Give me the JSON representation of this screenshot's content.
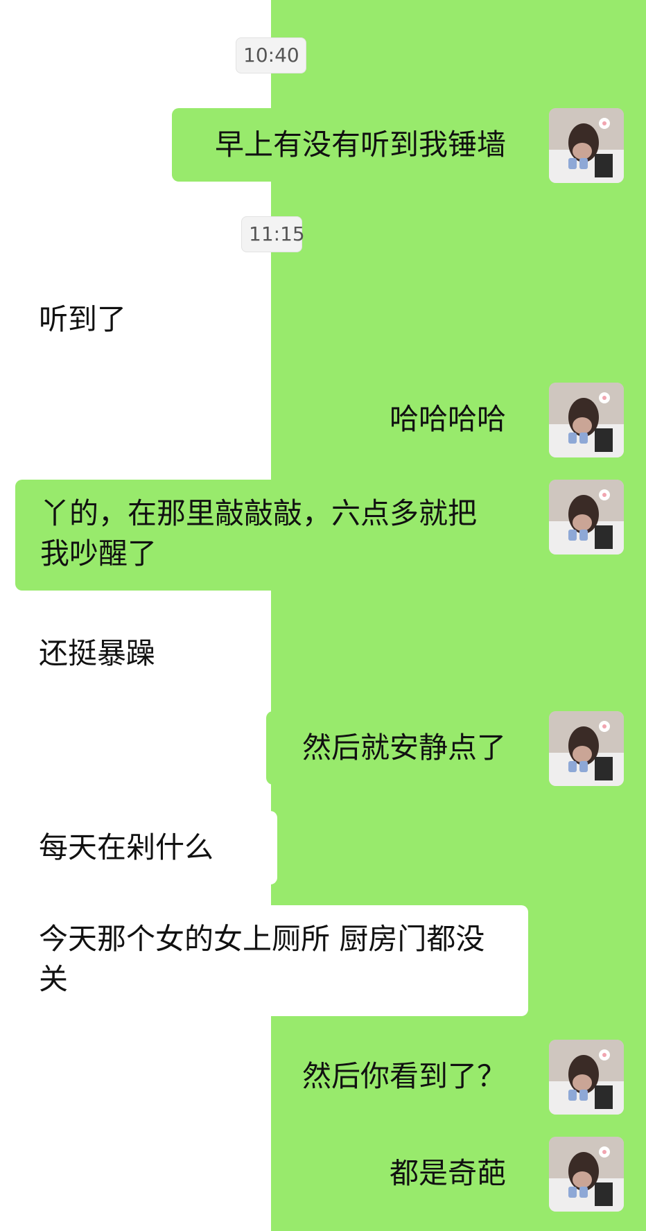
{
  "theme": {
    "right_background": "#98ea6c",
    "left_background": "#ffffff",
    "outgoing_bubble": "#98ea6c",
    "incoming_bubble": "#ffffff"
  },
  "timestamps": [
    {
      "label": "10:40"
    },
    {
      "label": "11:15"
    }
  ],
  "messages": [
    {
      "side": "right",
      "text": "早上有没有听到我锤墙",
      "avatar_icon": "user-avatar-icon"
    },
    {
      "side": "left",
      "text": "听到了"
    },
    {
      "side": "right",
      "text": "哈哈哈哈",
      "avatar_icon": "user-avatar-icon"
    },
    {
      "side": "right",
      "text": "丫的，在那里敲敲敲，六点多就把我吵醒了",
      "avatar_icon": "user-avatar-icon"
    },
    {
      "side": "left",
      "text": "还挺暴躁"
    },
    {
      "side": "right",
      "text": "然后就安静点了",
      "avatar_icon": "user-avatar-icon"
    },
    {
      "side": "left",
      "text": "每天在剁什么"
    },
    {
      "side": "left",
      "text": "今天那个女的女上厕所 厨房门都没关"
    },
    {
      "side": "right",
      "text": "然后你看到了？",
      "avatar_icon": "user-avatar-icon"
    },
    {
      "side": "right",
      "text": "都是奇葩",
      "avatar_icon": "user-avatar-icon"
    }
  ]
}
